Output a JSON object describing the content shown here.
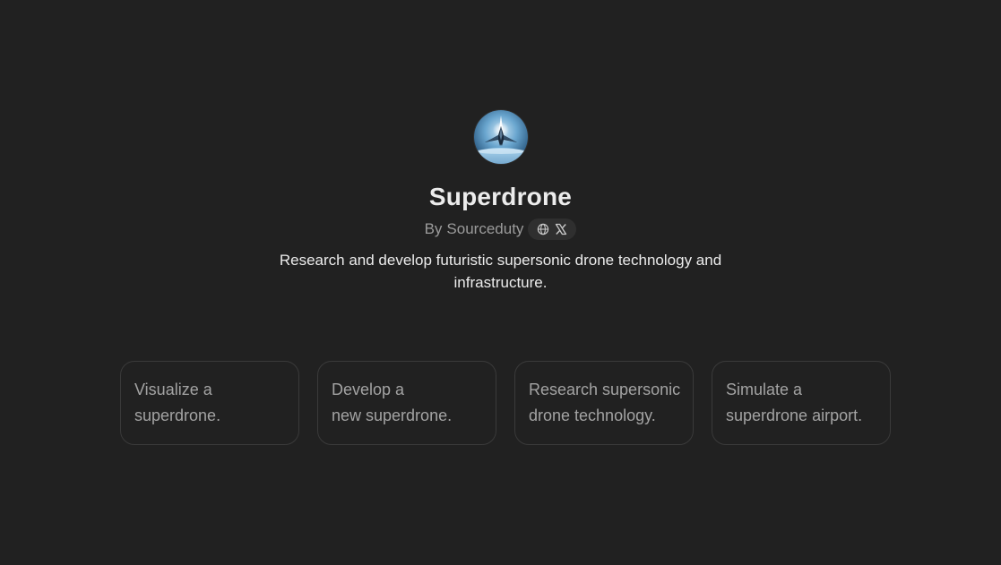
{
  "gpt": {
    "name": "Superdrone",
    "author_prefix": "By",
    "author": "Sourceduty",
    "description": "Research and develop futuristic supersonic drone technology and infrastructure.",
    "avatar_icon": "supersonic-jet-icon",
    "social_icons": [
      "globe-icon",
      "x-logo-icon"
    ]
  },
  "conversation_starters": [
    {
      "text": "Visualize a\nsuperdrone."
    },
    {
      "text": "Develop a\nnew superdrone."
    },
    {
      "text": "Research supersonic\ndrone technology."
    },
    {
      "text": "Simulate a\nsuperdrone airport."
    }
  ],
  "colors": {
    "background": "#212121",
    "card_border": "#3a3a3a",
    "pill_bg": "#2f2f2f",
    "text_primary": "#ececec",
    "text_muted": "#9b9b9b"
  }
}
